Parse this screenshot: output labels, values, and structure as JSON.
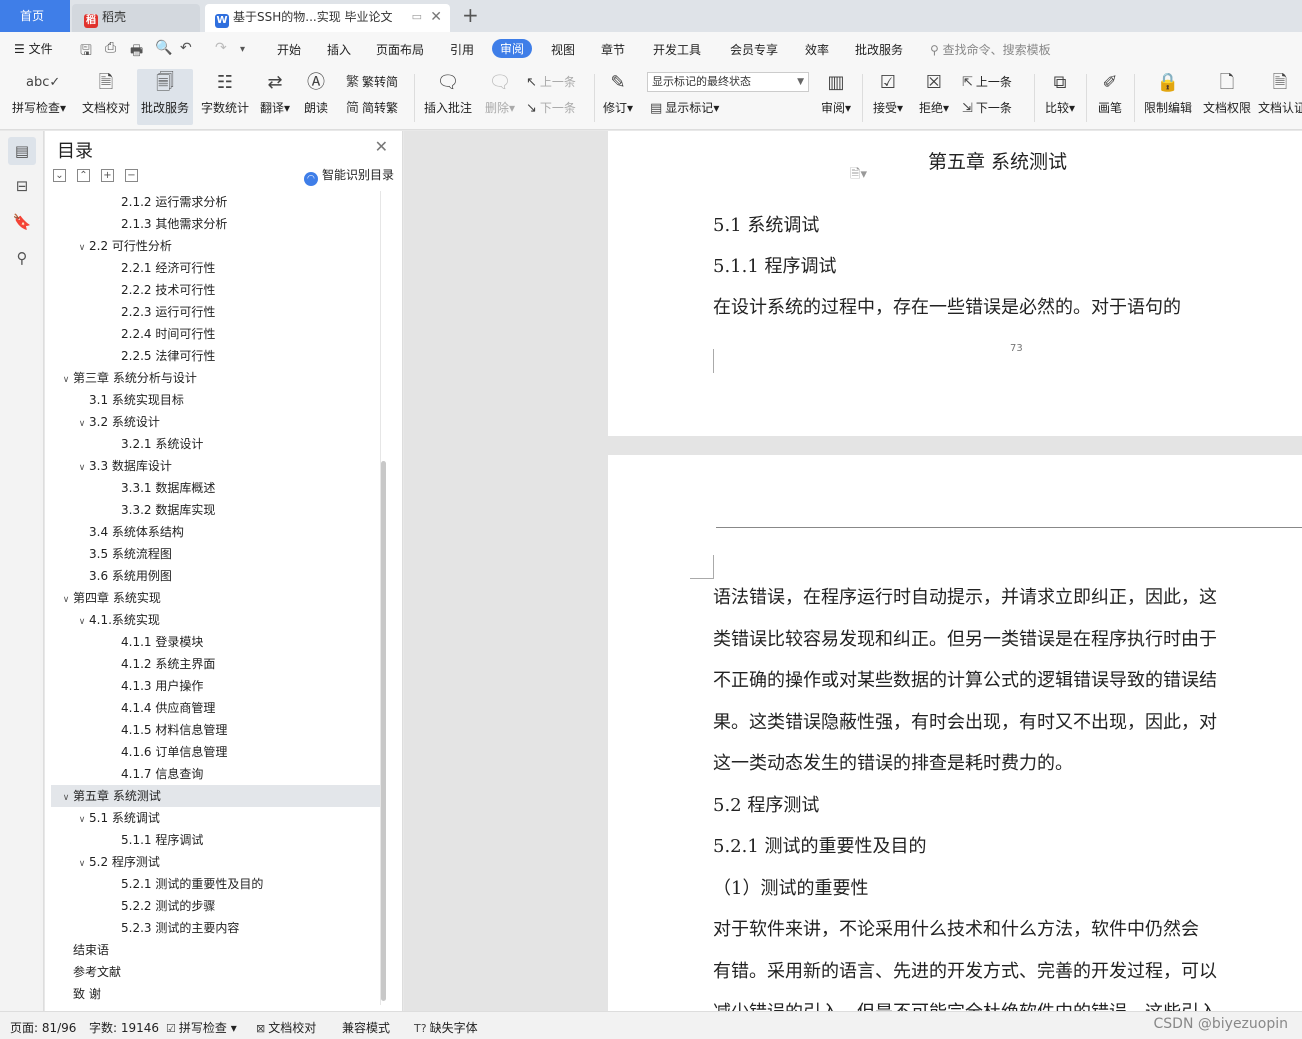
{
  "tabs": {
    "home": "首页",
    "daoke": "稻壳",
    "doc": "基于SSH的物...实现 毕业论文",
    "add": "+"
  },
  "menu": {
    "file": "文件",
    "items": [
      "开始",
      "插入",
      "页面布局",
      "引用",
      "审阅",
      "视图",
      "章节",
      "开发工具",
      "会员专享",
      "效率",
      "批改服务"
    ],
    "active": "审阅",
    "search": "查找命令、搜索模板"
  },
  "ribbon": {
    "spell": "拼写检查",
    "proof": "文档校对",
    "correct_service": "批改服务",
    "word_count": "字数统计",
    "translate": "翻译",
    "read": "朗读",
    "trad": "繁转简",
    "simp": "简转繁",
    "insert_comment": "插入批注",
    "delete": "删除",
    "prev": "上一条",
    "next": "下一条",
    "revise": "修订",
    "markup_state": "显示标记的最终状态",
    "show_markup": "显示标记",
    "review": "审阅",
    "accept": "接受",
    "reject": "拒绝",
    "prev2": "上一条",
    "next2": "下一条",
    "compare": "比较",
    "pen": "画笔",
    "restrict": "限制编辑",
    "permission": "文档权限",
    "certify": "文档认证"
  },
  "toc": {
    "title": "目录",
    "smart": "智能识别目录",
    "items": [
      {
        "t": "2.1.2 运行需求分析",
        "lvl": 3,
        "arrow": false
      },
      {
        "t": "2.1.3 其他需求分析",
        "lvl": 3,
        "arrow": false
      },
      {
        "t": "2.2  可行性分析",
        "lvl": 2,
        "arrow": true
      },
      {
        "t": "2.2.1 经济可行性",
        "lvl": 3,
        "arrow": false
      },
      {
        "t": "2.2.2 技术可行性",
        "lvl": 3,
        "arrow": false
      },
      {
        "t": "2.2.3  运行可行性",
        "lvl": 3,
        "arrow": false
      },
      {
        "t": "2.2.4 时间可行性",
        "lvl": 3,
        "arrow": false
      },
      {
        "t": "2.2.5  法律可行性",
        "lvl": 3,
        "arrow": false
      },
      {
        "t": "第三章  系统分析与设计",
        "lvl": 1,
        "arrow": true
      },
      {
        "t": "3.1 系统实现目标",
        "lvl": 2,
        "arrow": false
      },
      {
        "t": "3.2  系统设计",
        "lvl": 2,
        "arrow": true
      },
      {
        "t": "3.2.1 系统设计",
        "lvl": 3,
        "arrow": false
      },
      {
        "t": "3.3 数据库设计",
        "lvl": 2,
        "arrow": true
      },
      {
        "t": "3.3.1 数据库概述",
        "lvl": 3,
        "arrow": false
      },
      {
        "t": "3.3.2 数据库实现",
        "lvl": 3,
        "arrow": false
      },
      {
        "t": "3.4 系统体系结构",
        "lvl": 2,
        "arrow": false
      },
      {
        "t": "3.5 系统流程图",
        "lvl": 2,
        "arrow": false
      },
      {
        "t": "3.6 系统用例图",
        "lvl": 2,
        "arrow": false
      },
      {
        "t": "第四章  系统实现",
        "lvl": 1,
        "arrow": true
      },
      {
        "t": "4.1.系统实现",
        "lvl": 2,
        "arrow": true
      },
      {
        "t": "4.1.1  登录模块",
        "lvl": 3,
        "arrow": false
      },
      {
        "t": "4.1.2 系统主界面",
        "lvl": 3,
        "arrow": false
      },
      {
        "t": "4.1.3 用户操作",
        "lvl": 3,
        "arrow": false
      },
      {
        "t": "4.1.4 供应商管理",
        "lvl": 3,
        "arrow": false
      },
      {
        "t": "4.1.5 材料信息管理",
        "lvl": 3,
        "arrow": false
      },
      {
        "t": "4.1.6 订单信息管理",
        "lvl": 3,
        "arrow": false
      },
      {
        "t": "4.1.7 信息查询",
        "lvl": 3,
        "arrow": false
      },
      {
        "t": "第五章    系统测试",
        "lvl": 1,
        "arrow": true,
        "sel": true
      },
      {
        "t": "5.1 系统调试",
        "lvl": 2,
        "arrow": true
      },
      {
        "t": "5.1.1  程序调试",
        "lvl": 3,
        "arrow": false
      },
      {
        "t": "5.2  程序测试",
        "lvl": 2,
        "arrow": true
      },
      {
        "t": "5.2.1  测试的重要性及目的",
        "lvl": 3,
        "arrow": false
      },
      {
        "t": "5.2.2  测试的步骤",
        "lvl": 3,
        "arrow": false
      },
      {
        "t": "5.2.3  测试的主要内容",
        "lvl": 3,
        "arrow": false
      },
      {
        "t": "结束语",
        "lvl": 1,
        "arrow": false
      },
      {
        "t": "参考文献",
        "lvl": 1,
        "arrow": false
      },
      {
        "t": "致    谢",
        "lvl": 1,
        "arrow": false
      }
    ]
  },
  "document": {
    "chapter": "第五章    系统测试",
    "p1_lines": [
      "5.1 系统调试",
      "5.1.1  程序调试",
      "    在设计系统的过程中，存在一些错误是必然的。对于语句的"
    ],
    "page_number": "73",
    "p2_lines": [
      "语法错误，在程序运行时自动提示，并请求立即纠正，因此，这",
      "类错误比较容易发现和纠正。但另一类错误是在程序执行时由于",
      "不正确的操作或对某些数据的计算公式的逻辑错误导致的错误结",
      "果。这类错误隐蔽性强，有时会出现，有时又不出现，因此，对",
      "这一类动态发生的错误的排查是耗时费力的。",
      "5.2  程序测试",
      "5.2.1  测试的重要性及目的",
      "（1）测试的重要性",
      "    对于软件来讲，不论采用什么技术和什么方法，软件中仍然会",
      "有错。采用新的语言、先进的开发方式、完善的开发过程，可以",
      "减少错误的引入，但是不可能完全杜绝软件中的错误，这些引入"
    ]
  },
  "status": {
    "page": "页面: 81/96",
    "words": "字数: 19146",
    "spell": "拼写检查",
    "proof": "文档校对",
    "compat": "兼容模式",
    "missing_font": "缺失字体",
    "watermark": "CSDN @biyezuopin"
  }
}
